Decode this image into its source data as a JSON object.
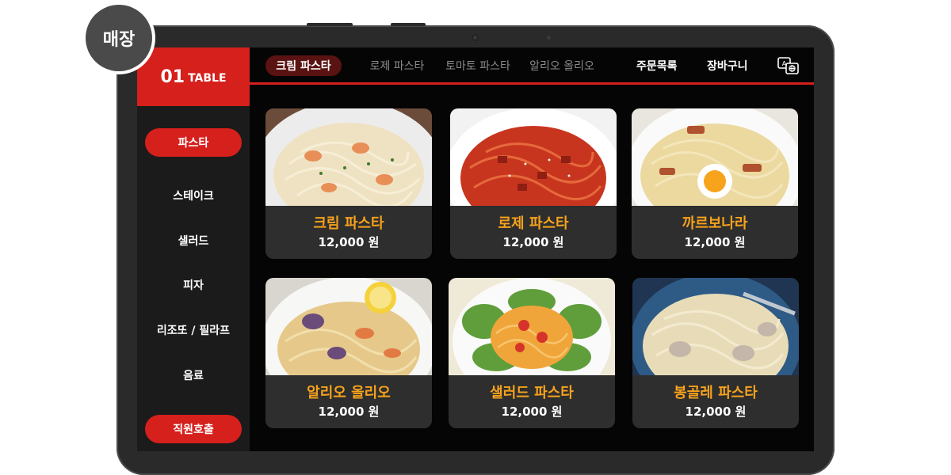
{
  "store_badge": "매장",
  "table": {
    "number": "01",
    "label": "TABLE"
  },
  "sidebar": {
    "items": [
      {
        "label": "파스타",
        "active": true
      },
      {
        "label": "스테이크",
        "active": false
      },
      {
        "label": "샐러드",
        "active": false
      },
      {
        "label": "피자",
        "active": false
      },
      {
        "label": "리조또 / 필라프",
        "active": false
      },
      {
        "label": "음료",
        "active": false
      }
    ],
    "call_staff": "직원호출"
  },
  "tabs": [
    {
      "label": "크림 파스타",
      "active": true
    },
    {
      "label": "로제 파스타",
      "active": false
    },
    {
      "label": "토마토 파스타",
      "active": false
    },
    {
      "label": "알리오 올리오",
      "active": false
    }
  ],
  "actions": {
    "order_list": "주문목록",
    "cart": "장바구니",
    "language_icon": "language-translate-icon"
  },
  "colors": {
    "accent": "#d5201c",
    "name": "#f7a21c",
    "card": "#2e2e2e"
  },
  "menu": [
    {
      "name": "크림 파스타",
      "price": "12,000 원",
      "image": "cream-pasta"
    },
    {
      "name": "로제 파스타",
      "price": "12,000 원",
      "image": "rose-pasta"
    },
    {
      "name": "까르보나라",
      "price": "12,000 원",
      "image": "carbonara"
    },
    {
      "name": "알리오 올리오",
      "price": "12,000 원",
      "image": "aglio-olio"
    },
    {
      "name": "샐러드 파스타",
      "price": "12,000 원",
      "image": "salad-pasta"
    },
    {
      "name": "봉골레 파스타",
      "price": "12,000 원",
      "image": "vongole-pasta"
    }
  ]
}
